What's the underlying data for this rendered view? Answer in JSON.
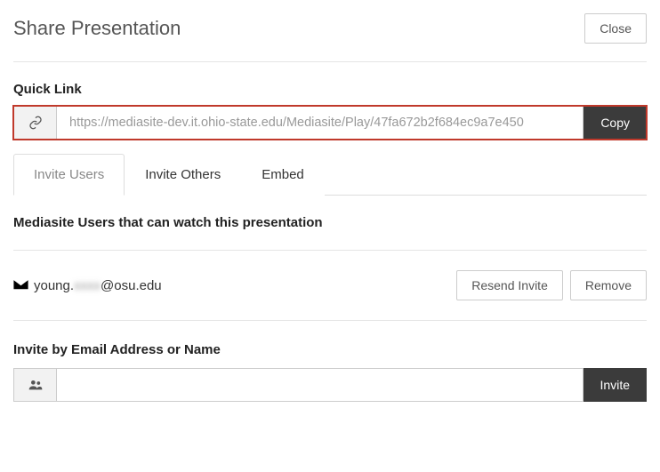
{
  "header": {
    "title": "Share Presentation",
    "close": "Close"
  },
  "quicklink": {
    "label": "Quick Link",
    "url": "https://mediasite-dev.it.ohio-state.edu/Mediasite/Play/47fa672b2f684ec9a7e450",
    "copy": "Copy"
  },
  "tabs": {
    "invite_users": "Invite Users",
    "invite_others": "Invite Others",
    "embed": "Embed"
  },
  "users": {
    "heading": "Mediasite Users that can watch this presentation",
    "items": [
      {
        "prefix": "young.",
        "masked": "xxxx",
        "suffix": "@osu.edu",
        "resend": "Resend Invite",
        "remove": "Remove"
      }
    ]
  },
  "inviteForm": {
    "label": "Invite by Email Address or Name",
    "value": "",
    "button": "Invite"
  }
}
